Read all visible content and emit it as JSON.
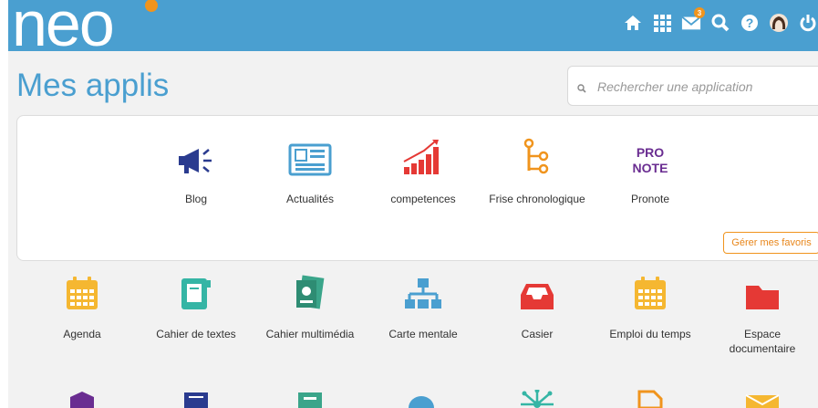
{
  "header": {
    "logo_text": "neo",
    "message_count": "3",
    "icons": [
      "home-icon",
      "apps-grid-icon",
      "mail-icon",
      "search-icon",
      "help-icon",
      "avatar",
      "power-icon"
    ],
    "color": "#4a9fd0"
  },
  "page": {
    "title": "Mes applis"
  },
  "search": {
    "placeholder": "Rechercher une application"
  },
  "favorites": {
    "apps": [
      {
        "label": "Blog",
        "icon": "megaphone-icon",
        "color": "#2a3b8f"
      },
      {
        "label": "Actualités",
        "icon": "newspaper-icon",
        "color": "#4a9fd0"
      },
      {
        "label": "competences",
        "icon": "bar-chart-icon",
        "color": "#e53935"
      },
      {
        "label": "Frise chronologique",
        "icon": "timeline-icon",
        "color": "#f0941d"
      },
      {
        "label": "Pronote",
        "icon": "pronote-logo",
        "color": "#6a2d91"
      }
    ],
    "manage_label": "Gérer mes favoris"
  },
  "apps": [
    {
      "label": "Agenda",
      "icon": "calendar-icon",
      "color": "#f5b731"
    },
    {
      "label": "Cahier de textes",
      "icon": "notebook-icon",
      "color": "#35b5a5"
    },
    {
      "label": "Cahier multimédia",
      "icon": "multimedia-notebook-icon",
      "color": "#3aa58a"
    },
    {
      "label": "Carte mentale",
      "icon": "mind-map-icon",
      "color": "#4a9fd0"
    },
    {
      "label": "Casier",
      "icon": "inbox-tray-icon",
      "color": "#e53935"
    },
    {
      "label": "Emploi du temps",
      "icon": "calendar-icon",
      "color": "#f5b731"
    },
    {
      "label": "Espace documentaire",
      "icon": "folder-icon",
      "color": "#e53935"
    }
  ]
}
